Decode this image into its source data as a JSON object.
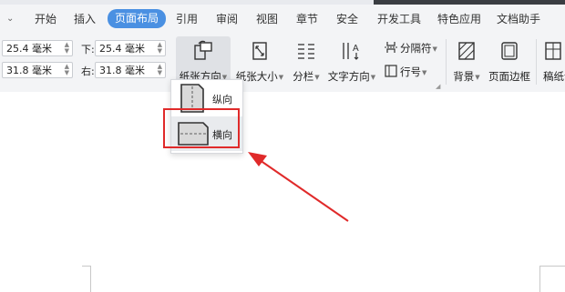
{
  "tabs": {
    "chevron": "ᯤ",
    "items": [
      "开始",
      "插入",
      "页面布局",
      "引用",
      "审阅",
      "视图",
      "章节",
      "安全",
      "开发工具",
      "特色应用",
      "文档助手"
    ],
    "active": "页面布局"
  },
  "margins": {
    "top_value": "25.4 毫米",
    "bottom_label": "下:",
    "bottom_value": "25.4 毫米",
    "left_value": "31.8 毫米",
    "right_label": "右:",
    "right_value": "31.8 毫米"
  },
  "ribbon": {
    "orientation": "纸张方向",
    "size": "纸张大小",
    "columns": "分栏",
    "text_direction": "文字方向",
    "separator": "分隔符",
    "line_number": "行号",
    "background": "背景",
    "page_border": "页面边框",
    "manuscript": "稿纸设"
  },
  "dropdown": {
    "portrait": "纵向",
    "landscape": "横向"
  },
  "annotation": {
    "color": "#e02a2a"
  }
}
